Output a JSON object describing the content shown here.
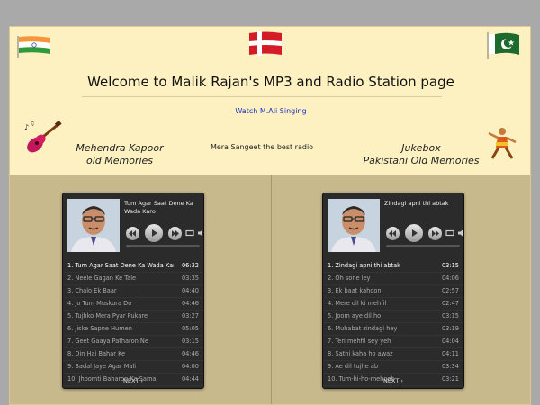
{
  "header": {
    "title": "Welcome to Malik Rajan's MP3 and Radio Station page",
    "watch_link": "Watch M.Ali Singing"
  },
  "captions": {
    "left_line1": "Mehendra Kapoor",
    "left_line2": "old  Memories",
    "middle": "Mera Sangeet the best radio",
    "right_line1": "Jukebox",
    "right_line2": "Pakistani Old Memories"
  },
  "player_left": {
    "now_playing": "Tum Agar Saat Dene Ka Wada Karo",
    "tracks": [
      {
        "title": "1. Tum Agar Saat Dene Ka Wada Karo",
        "duration": "06:32"
      },
      {
        "title": "2. Neele Gagan Ke Tale",
        "duration": "03:35"
      },
      {
        "title": "3. Chalo Ek Baar",
        "duration": "04:40"
      },
      {
        "title": "4. Jo Tum Muskura Do",
        "duration": "04:46"
      },
      {
        "title": "5. Tujhko Mera Pyar Pukare",
        "duration": "03:27"
      },
      {
        "title": "6. Jiske Sapne Humen",
        "duration": "05:05"
      },
      {
        "title": "7. Geet Gaaya Patharon Ne",
        "duration": "03:15"
      },
      {
        "title": "8. Din Hai Bahar Ke",
        "duration": "04:46"
      },
      {
        "title": "9. Badal Jaye Agar Mali",
        "duration": "04:00"
      },
      {
        "title": "10. Jhoomti Baharon Ka Sama",
        "duration": "04:44"
      }
    ],
    "next_label": "NEXT ›"
  },
  "player_right": {
    "now_playing": "Zindagi apni thi abtak",
    "tracks": [
      {
        "title": "1. Zindagi apni thi abtak",
        "duration": "03:15"
      },
      {
        "title": "2. Oh sone ley",
        "duration": "04:06"
      },
      {
        "title": "3. Ek baat kahoon",
        "duration": "02:57"
      },
      {
        "title": "4. Mere dil ki mehfil",
        "duration": "02:47"
      },
      {
        "title": "5. Joom aye dil ho",
        "duration": "03:15"
      },
      {
        "title": "6. Muhabat zindagi hey",
        "duration": "03:19"
      },
      {
        "title": "7. Teri mehfil sey yeh",
        "duration": "04:04"
      },
      {
        "title": "8. Sathi kaha ho awaz",
        "duration": "04:11"
      },
      {
        "title": "9. Ae dil tujhe ab",
        "duration": "03:34"
      },
      {
        "title": "10. Tum-hi-ho-mehoob",
        "duration": "03:21"
      }
    ],
    "next_label": "NEXT ›"
  },
  "colors": {
    "page_bg": "#fdf1c1",
    "panel_bg": "#c8b98d",
    "player_bg": "#2b2b2b",
    "link": "#1a2fc4"
  }
}
